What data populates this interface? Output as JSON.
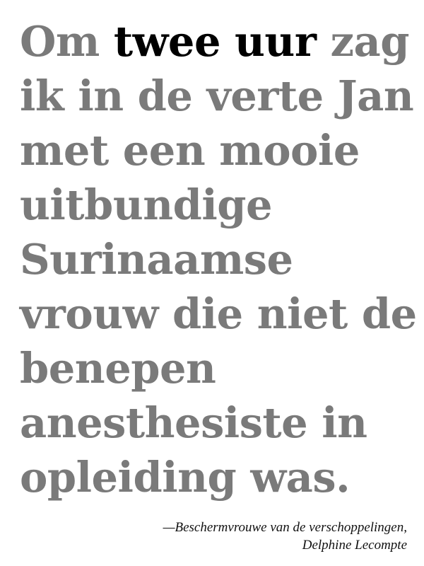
{
  "quote": {
    "line1_pre": "Om ",
    "line1_highlight": "twee uur",
    "line1_post": " zag",
    "lines": [
      "ik in de verte Jan",
      "met een mooie",
      "uitbundige",
      "Surinaamse",
      "vrouw die niet de",
      "benepen",
      "anesthesiste in",
      "opleiding was."
    ]
  },
  "attribution": {
    "work": "—Beschermvrouwe van de verschoppelingen,",
    "author": "Delphine Lecompte"
  },
  "colors": {
    "text": "#7a7a7a",
    "highlight": "#000000",
    "background": "#ffffff"
  }
}
